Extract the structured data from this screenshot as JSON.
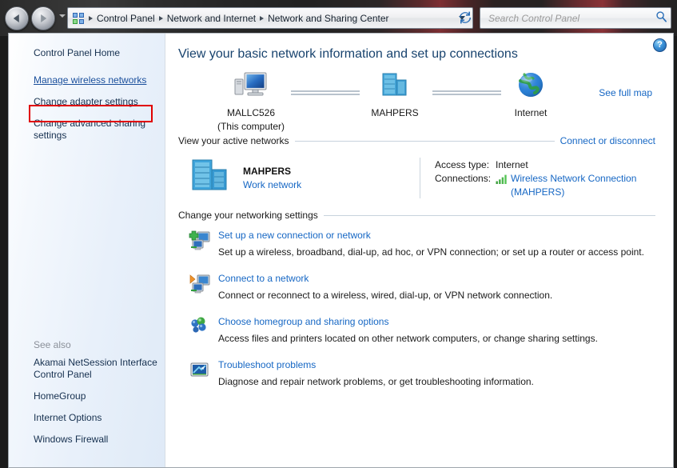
{
  "window": {
    "address_bar": {
      "icon": "control-panel-icon",
      "breadcrumbs": [
        "Control Panel",
        "Network and Internet",
        "Network and Sharing Center"
      ],
      "dropdown_icon": "chevron-down-icon",
      "refresh_icon": "refresh-icon"
    },
    "search": {
      "placeholder": "Search Control Panel",
      "value": "",
      "icon": "search-icon"
    },
    "nav": {
      "back_icon": "back-arrow-icon",
      "forward_icon": "forward-arrow-icon",
      "history_icon": "chevron-down-icon"
    }
  },
  "sidebar": {
    "home_label": "Control Panel Home",
    "tasks": [
      {
        "label": "Manage wireless networks",
        "highlighted": true
      },
      {
        "label": "Change adapter settings",
        "highlighted": false
      },
      {
        "label": "Change advanced sharing settings",
        "highlighted": false
      }
    ],
    "see_also_title": "See also",
    "see_also": [
      {
        "label": "Akamai NetSession Interface Control Panel"
      },
      {
        "label": "HomeGroup"
      },
      {
        "label": "Internet Options"
      },
      {
        "label": "Windows Firewall"
      }
    ],
    "highlight_color": "#e00000"
  },
  "content": {
    "help_icon": "help-question-icon",
    "help_label": "?",
    "heading": "View your basic network information and set up connections",
    "network_map": {
      "see_full_map_label": "See full map",
      "nodes": [
        {
          "icon": "computer-icon",
          "label": "MALLC526",
          "sublabel": "(This computer)"
        },
        {
          "icon": "network-server-icon",
          "label": "MAHPERS",
          "sublabel": ""
        },
        {
          "icon": "globe-icon",
          "label": "Internet",
          "sublabel": ""
        }
      ]
    },
    "active_networks": {
      "section_title": "View your active networks",
      "action_label": "Connect or disconnect",
      "network": {
        "icon": "network-server-icon",
        "name": "MAHPERS",
        "type": "Work network",
        "details": [
          {
            "label": "Access type:",
            "value": "Internet",
            "is_link": false,
            "icon": ""
          },
          {
            "label": "Connections:",
            "value": "Wireless Network Connection (MAHPERS)",
            "is_link": true,
            "icon": "wifi-signal-icon"
          }
        ]
      }
    },
    "networking_settings": {
      "section_title": "Change your networking settings",
      "items": [
        {
          "icon": "add-connection-icon",
          "title": "Set up a new connection or network",
          "description": "Set up a wireless, broadband, dial-up, ad hoc, or VPN connection; or set up a router or access point."
        },
        {
          "icon": "connect-network-icon",
          "title": "Connect to a network",
          "description": "Connect or reconnect to a wireless, wired, dial-up, or VPN network connection."
        },
        {
          "icon": "homegroup-icon",
          "title": "Choose homegroup and sharing options",
          "description": "Access files and printers located on other network computers, or change sharing settings."
        },
        {
          "icon": "troubleshoot-icon",
          "title": "Troubleshoot problems",
          "description": "Diagnose and repair network problems, or get troubleshooting information."
        }
      ]
    }
  },
  "colors": {
    "link": "#1667c4",
    "heading": "#18436e",
    "sidebar_text": "#16304f",
    "highlight": "#e00000"
  }
}
